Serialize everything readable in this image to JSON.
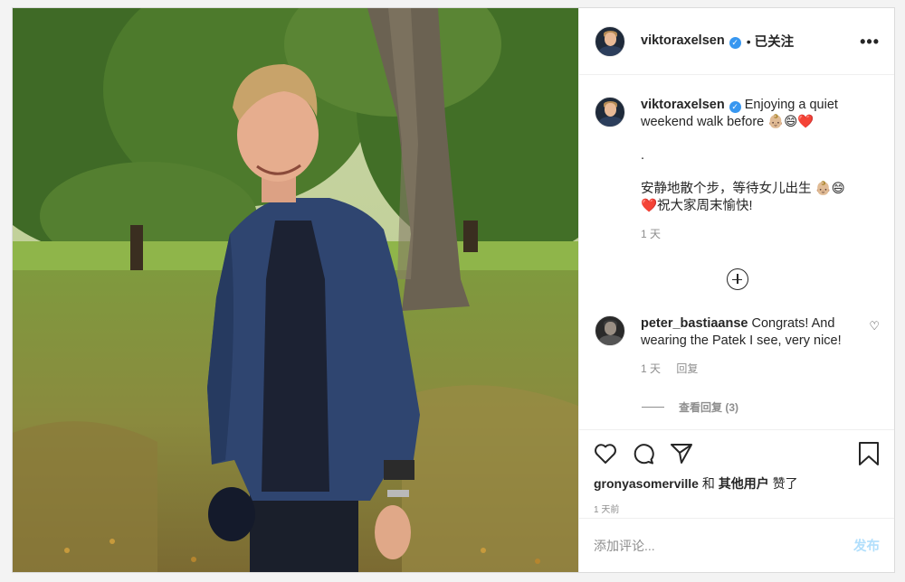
{
  "header": {
    "username": "viktoraxelsen",
    "verified_mark": "✓",
    "separator": "•",
    "follow_status": "已关注",
    "more": "•••"
  },
  "caption": {
    "username": "viktoraxelsen",
    "text_line1": "Enjoying a quiet",
    "text_line2": "weekend walk before 👶🏼😄❤️",
    "dot": ".",
    "cn_line1": "安静地散个步，等待女儿出生 👶🏼😄",
    "cn_line2": "❤️祝大家周末愉快!",
    "time": "1 天"
  },
  "comment": {
    "username": "peter_bastiaanse",
    "text": "Congrats! And wearing the Patek I see, very nice!",
    "time": "1 天",
    "reply_label": "回复",
    "heart": "♡",
    "view_replies": "查看回复 (3)"
  },
  "actions": {
    "liked_by_user": "gronyasomerville",
    "liked_and": "和",
    "liked_others": "其他用户",
    "liked_suffix": "赞了",
    "time_ago": "1 天前"
  },
  "add_comment": {
    "placeholder": "添加评论...",
    "post_label": "发布"
  },
  "colors": {
    "verified": "#3897f0",
    "post_disabled": "#b2dffc",
    "secondary_text": "#8e8e8e"
  }
}
